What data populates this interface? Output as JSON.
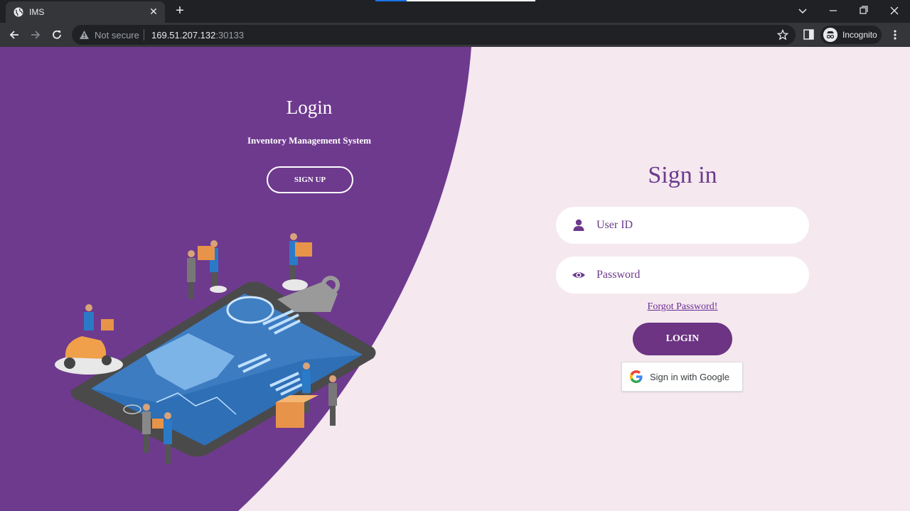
{
  "browser": {
    "tab_title": "IMS",
    "tab_close_glyph": "✕",
    "new_tab_glyph": "+",
    "security_label": "Not secure",
    "url_host": "169.51.207.132",
    "url_port": ":30133",
    "profile_label": "Incognito",
    "icons": [
      "globe-icon",
      "close-icon",
      "plus-icon",
      "chevron-down-icon",
      "minimize-icon",
      "restore-icon",
      "window-close-icon",
      "back-arrow-icon",
      "forward-arrow-icon",
      "reload-icon",
      "warning-icon",
      "star-icon",
      "side-panel-icon",
      "incognito-icon",
      "more-vert-icon"
    ]
  },
  "left_panel": {
    "title": "Login",
    "subtitle": "Inventory Management System",
    "signup_label": "SIGN UP",
    "illustration": "inventory-clipboard-illustration"
  },
  "signin": {
    "title": "Sign in",
    "user_placeholder": "User ID",
    "password_placeholder": "Password",
    "forgot_label": "Forgot Password!",
    "login_label": "LOGIN",
    "google_label": "Sign in with Google",
    "icons": [
      "user-icon",
      "eye-icon",
      "google-icon"
    ]
  },
  "colors": {
    "purple_panel": "#6e3a8e",
    "page_background": "#f5e8ef",
    "accent": "#6c3483",
    "chrome_dark": "#202124",
    "chrome_toolbar": "#35363a"
  }
}
